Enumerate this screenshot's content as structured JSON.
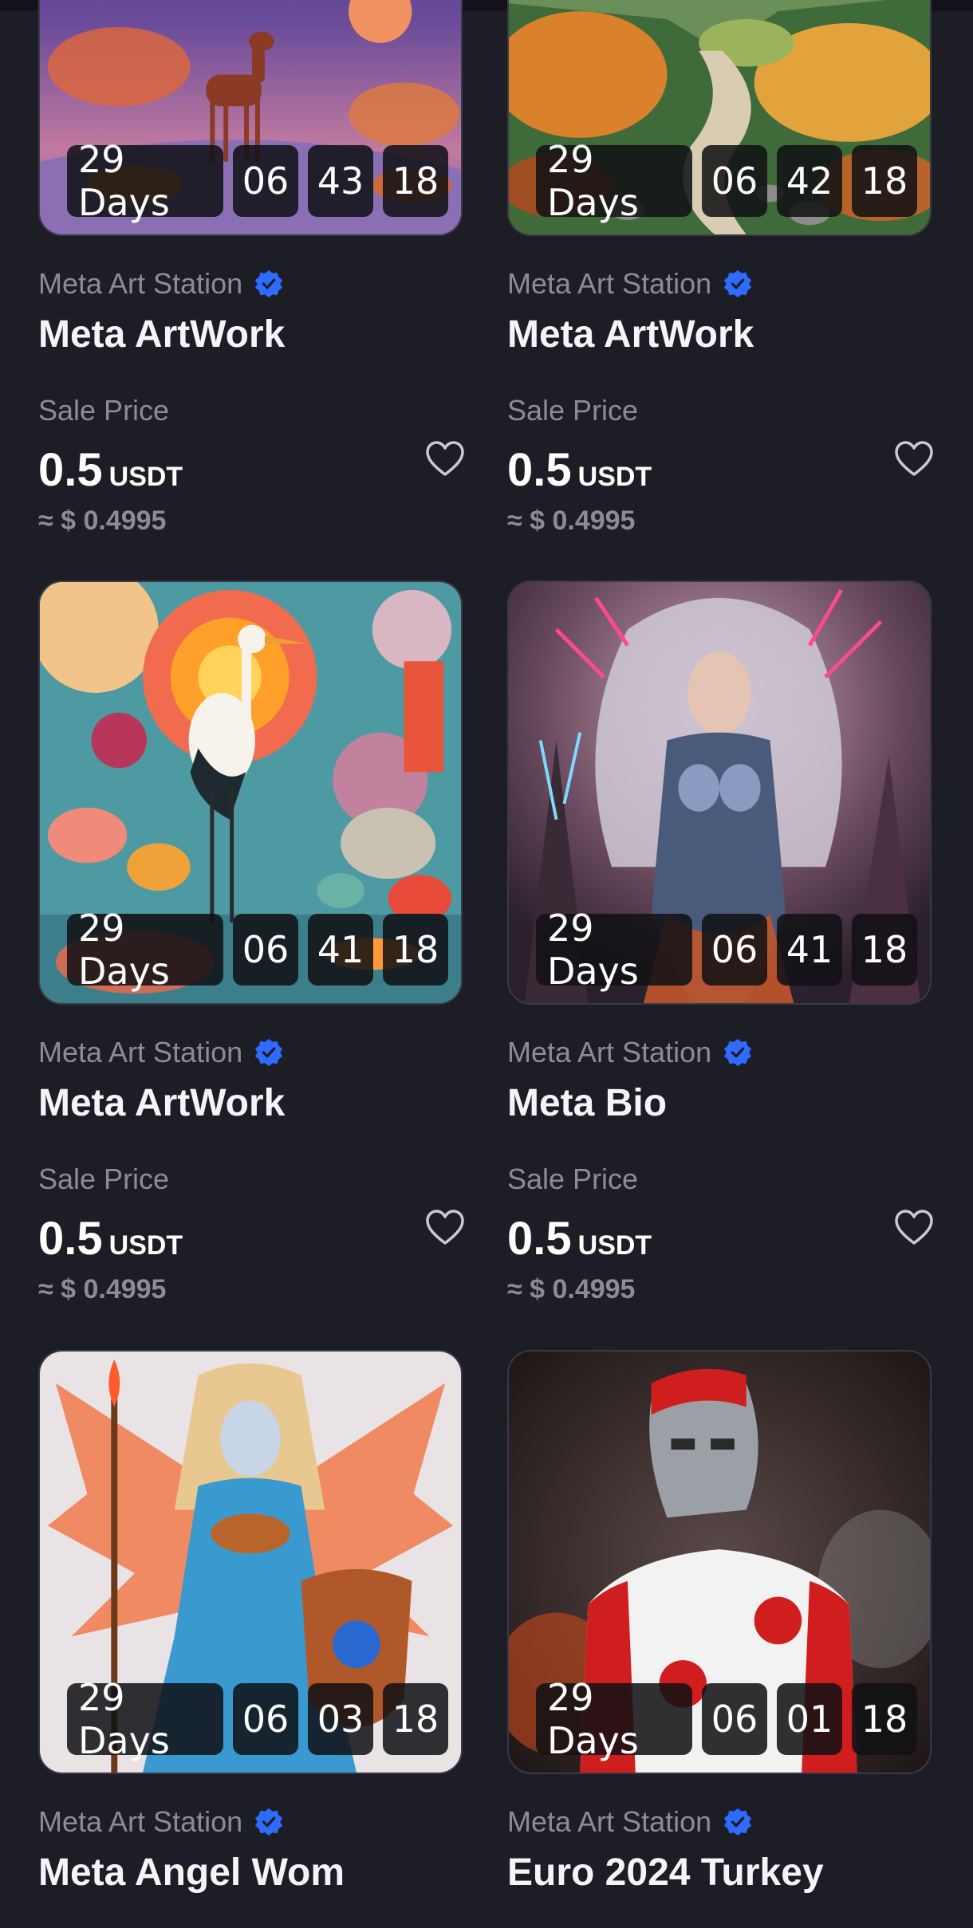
{
  "cards": [
    {
      "timer": {
        "days": "29 Days",
        "hours": "06",
        "minutes": "43",
        "seconds": "18"
      },
      "creator": "Meta Art Station",
      "title": "Meta ArtWork",
      "sale_label": "Sale Price",
      "price": "0.5",
      "unit": "USDT",
      "fiat": "≈ $ 0.4995"
    },
    {
      "timer": {
        "days": "29 Days",
        "hours": "06",
        "minutes": "42",
        "seconds": "18"
      },
      "creator": "Meta Art Station",
      "title": "Meta ArtWork",
      "sale_label": "Sale Price",
      "price": "0.5",
      "unit": "USDT",
      "fiat": "≈ $ 0.4995"
    },
    {
      "timer": {
        "days": "29 Days",
        "hours": "06",
        "minutes": "41",
        "seconds": "18"
      },
      "creator": "Meta Art Station",
      "title": "Meta ArtWork",
      "sale_label": "Sale Price",
      "price": "0.5",
      "unit": "USDT",
      "fiat": "≈ $ 0.4995"
    },
    {
      "timer": {
        "days": "29 Days",
        "hours": "06",
        "minutes": "41",
        "seconds": "18"
      },
      "creator": "Meta Art Station",
      "title": "Meta Bio",
      "sale_label": "Sale Price",
      "price": "0.5",
      "unit": "USDT",
      "fiat": "≈ $ 0.4995"
    },
    {
      "timer": {
        "days": "29 Days",
        "hours": "06",
        "minutes": "03",
        "seconds": "18"
      },
      "creator": "Meta Art Station",
      "title": "Meta Angel Wom"
    },
    {
      "timer": {
        "days": "29 Days",
        "hours": "06",
        "minutes": "01",
        "seconds": "18"
      },
      "creator": "Meta Art Station",
      "title": "Euro 2024 Turkey"
    }
  ],
  "colors": {
    "background": "#1d1d26",
    "muted_text": "#8c8c99",
    "verified_badge": "#2f6bff"
  },
  "icons": {
    "verified": "verified-badge-icon",
    "favorite": "heart-outline-icon"
  }
}
